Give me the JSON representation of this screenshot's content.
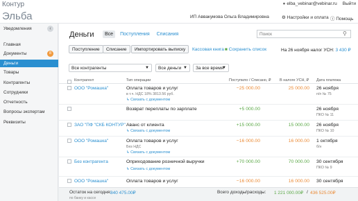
{
  "topbar": {
    "brand": "Контур",
    "email": "elba_vebinar@vebinar.ru",
    "logout": "Выйти"
  },
  "header": {
    "logo": "Эльба",
    "company": "ИП Аввакумова Ольга Владимировна",
    "settings": "Настройки и оплата",
    "help": "Помощь"
  },
  "sidebar": {
    "notifications": "Уведомления",
    "items": [
      {
        "label": "Главная"
      },
      {
        "label": "Документы",
        "badge": "8"
      },
      {
        "label": "Деньги"
      },
      {
        "label": "Товары"
      },
      {
        "label": "Контрагенты"
      },
      {
        "label": "Сотрудники"
      },
      {
        "label": "Отчетность"
      },
      {
        "label": "Вопросы экспертам"
      },
      {
        "label": "Реквизиты"
      }
    ]
  },
  "main": {
    "title": "Деньги",
    "tabs": [
      "Все",
      "Поступления",
      "Списания"
    ],
    "search_placeholder": "Поиск",
    "actions": [
      "Поступление",
      "Списание",
      "Импортировать выписку"
    ],
    "cashbook": "Кассовая книга",
    "save_list": "Сохранить список",
    "tax_text": "На 26 ноября налог УСН:",
    "tax_value": "3 430 ₽",
    "filters": [
      "Все контрагенты",
      "Все деньги",
      "За все время"
    ],
    "columns": {
      "counterparty": "Контрагент",
      "optype": "Тип операции",
      "amount": "Поступило / Списано, ₽",
      "tax": "В налоге УСН, ₽",
      "date": "Дата платежа"
    },
    "rows": [
      {
        "counterparty": "ООО \"Ромашка\"",
        "op": "Оплата товаров и услуг",
        "sub": "в т.ч. НДС 18% 3813.56 руб.",
        "link": "Связать с документом",
        "amount": "−25 000.00",
        "tax": "25 000.00",
        "date": "26 ноября",
        "doc": "п/п № 75"
      },
      {
        "counterparty": "",
        "op": "Возврат переплаты по зарплате",
        "sub": "",
        "link": "",
        "amount": "+5 000.00",
        "tax": "",
        "date": "26 ноября",
        "doc": "ПКО № 11"
      },
      {
        "counterparty": "ЗАО \"ПФ \"СКБ КОНТУР\"",
        "op": "Аванс от клиента",
        "sub": "",
        "link": "Связать с документом",
        "amount": "+15 000.00",
        "tax": "15 000.00",
        "date": "26 ноября",
        "doc": "ПКО № 10"
      },
      {
        "counterparty": "ООО \"Ромашка\"",
        "op": "Оплата товаров и услуг",
        "sub": "Без НДС",
        "link": "Связать с документом",
        "amount": "−16 000.00",
        "tax": "16 000.00",
        "date": "1 октября",
        "doc": "б/н"
      },
      {
        "counterparty": "Без контрагента",
        "op": "Оприходование розничной выручки",
        "sub": "",
        "link": "Связать с документом",
        "amount": "+70 000.00",
        "tax": "70 000.00",
        "date": "30 сентября",
        "doc": "ПКО № 9"
      },
      {
        "counterparty": "ООО \"Ромашка\"",
        "op": "Оплата товаров и услуг",
        "sub": "",
        "link": "",
        "amount": "−16 000.00",
        "tax": "16 000.00",
        "date": "30 сентября",
        "doc": ""
      }
    ]
  },
  "footer": {
    "balance_label": "Остаток на сегодня:",
    "balance_value": "840 475.00₽",
    "balance_sub": "по банку и кассе",
    "total_label": "Всего доходы/расходы:",
    "income": "1 221 000.00₽",
    "sep": "/",
    "expense": "436 525.00₽"
  },
  "colors": {
    "accent": "#2a8fd0",
    "income": "#5ba847",
    "expense": "#ea8a35",
    "badge": "#f19a3e"
  },
  "icons": [
    "user-icon",
    "gear-icon",
    "help-icon",
    "search-icon",
    "chevron-down-icon",
    "link-icon",
    "excel-icon"
  ]
}
